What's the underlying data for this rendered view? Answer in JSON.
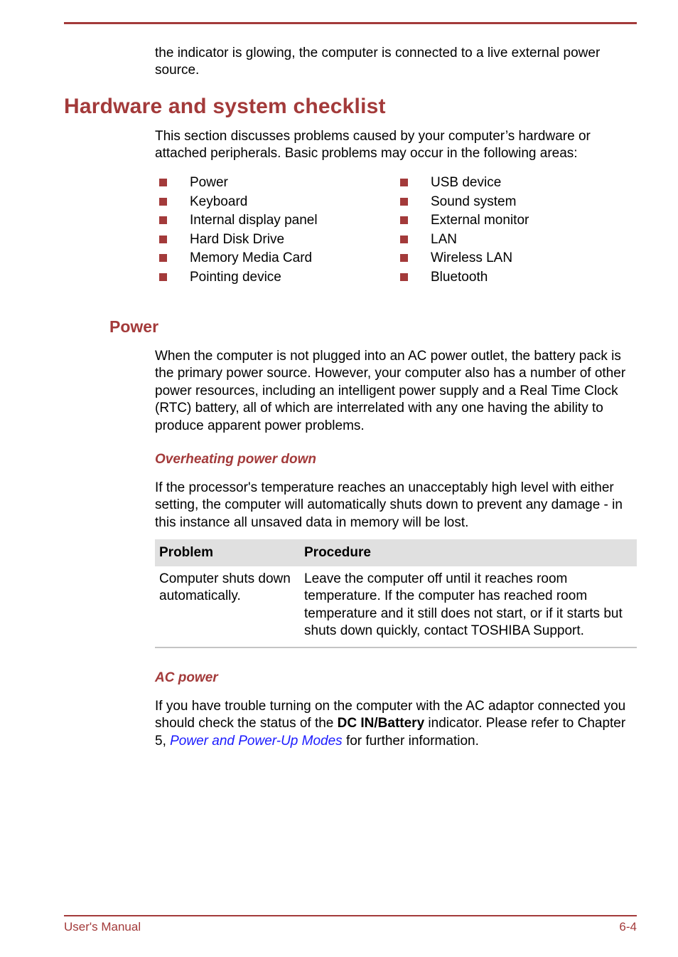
{
  "continuation": "the indicator is glowing, the computer is connected to a live external power source.",
  "section": {
    "title": "Hardware and system checklist",
    "intro": "This section discusses problems caused by your computer’s hardware or attached peripherals. Basic problems may occur in the following areas:",
    "areas_left": [
      "Power",
      "Keyboard",
      "Internal display panel",
      "Hard Disk Drive",
      "Memory Media Card",
      "Pointing device"
    ],
    "areas_right": [
      "USB device",
      "Sound system",
      "External monitor",
      "LAN",
      "Wireless LAN",
      "Bluetooth"
    ]
  },
  "power": {
    "title": "Power",
    "text": "When the computer is not plugged into an AC power outlet, the battery pack is the primary power source. However, your computer also has a number of other power resources, including an intelligent power supply and a Real Time Clock (RTC) battery, all of which are interrelated with any one having the ability to produce apparent power problems."
  },
  "overheating": {
    "title": "Overheating power down",
    "text": "If the processor's temperature reaches an unacceptably high level with either setting, the computer will automatically shuts down to prevent any damage - in this instance all unsaved data in memory will be lost.",
    "table": {
      "headers": [
        "Problem",
        "Procedure"
      ],
      "rows": [
        [
          "Computer shuts down automatically.",
          "Leave the computer off until it reaches room temperature. If the computer has reached room temperature and it still does not start, or if it starts but shuts down quickly, contact TOSHIBA Support."
        ]
      ]
    }
  },
  "ac_power": {
    "title": "AC power",
    "text_before": "If you have trouble turning on the computer with the AC adaptor connected you should check the status of the ",
    "bold": "DC IN/Battery",
    "text_middle": " indicator. Please refer to Chapter 5, ",
    "link": "Power and Power-Up Modes",
    "text_after": " for further information."
  },
  "footer": {
    "left": "User's Manual",
    "right": "6-4"
  },
  "colors": {
    "accent": "#a33a3a",
    "link": "#1a1aff",
    "table_header_bg": "#e0e0e0"
  }
}
